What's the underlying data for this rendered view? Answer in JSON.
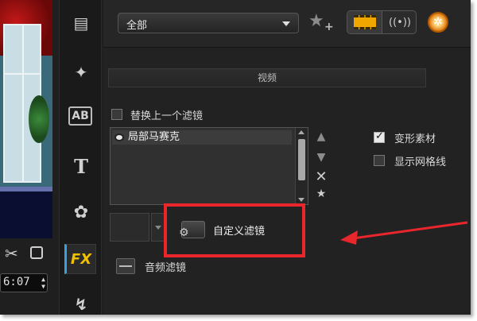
{
  "preview": {
    "tool_scissor_icon": "scissors-icon",
    "tool_copy_icon": "copy-icon",
    "timecode": "6:07"
  },
  "toolbar": {
    "items": [
      {
        "name": "media-library-icon",
        "glyph": "▤"
      },
      {
        "name": "instant-project-icon",
        "glyph": "✦"
      },
      {
        "name": "transition-icon",
        "glyph": "AB"
      },
      {
        "name": "title-icon",
        "glyph": "T"
      },
      {
        "name": "graphics-icon",
        "glyph": "✿"
      },
      {
        "name": "filter-fx-icon",
        "glyph": "FX"
      },
      {
        "name": "path-icon",
        "glyph": "↯"
      }
    ]
  },
  "header": {
    "category_value": "全部",
    "view_video_icon": "film-strip-icon",
    "view_audio_icon": "audio-icon",
    "settings_icon": "settings-wheel-icon"
  },
  "section": {
    "title": "视频"
  },
  "options": {
    "replace_last_filter_label": "替换上一个滤镜",
    "replace_last_filter_checked": false,
    "deform_clip_label": "变形素材",
    "deform_clip_checked": true,
    "show_grid_label": "显示网格线",
    "show_grid_checked": false
  },
  "filter_list": {
    "items": [
      "局部马赛克"
    ]
  },
  "custom_filter": {
    "label": "自定义滤镜"
  },
  "audio_filter": {
    "label": "音频滤镜"
  },
  "annotation": {
    "highlight_color": "#e8262b"
  }
}
